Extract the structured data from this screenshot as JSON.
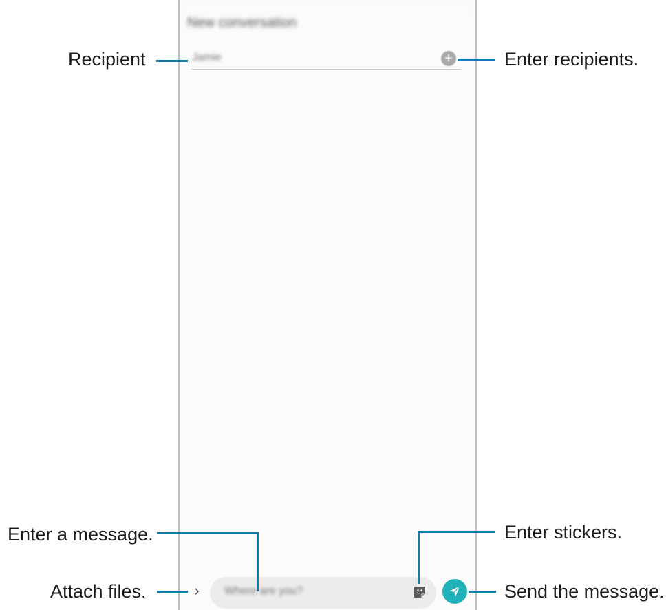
{
  "phone": {
    "title": "New conversation",
    "recipient_placeholder": "Jamie",
    "message_placeholder": "Where are you?",
    "add_symbol": "+",
    "attach_symbol": "›"
  },
  "callouts": {
    "recipient": "Recipient",
    "enter_recipients": "Enter recipients.",
    "enter_message": "Enter a message.",
    "enter_stickers": "Enter stickers.",
    "attach_files": "Attach files.",
    "send_message": "Send the message."
  },
  "colors": {
    "leader": "#0e7db3",
    "send_button": "#1fb2b8",
    "input_background": "#ececec"
  },
  "icons": {
    "add": "plus-circle-icon",
    "attach": "chevron-right-icon",
    "sticker": "sticker-icon",
    "send": "paper-plane-icon"
  }
}
